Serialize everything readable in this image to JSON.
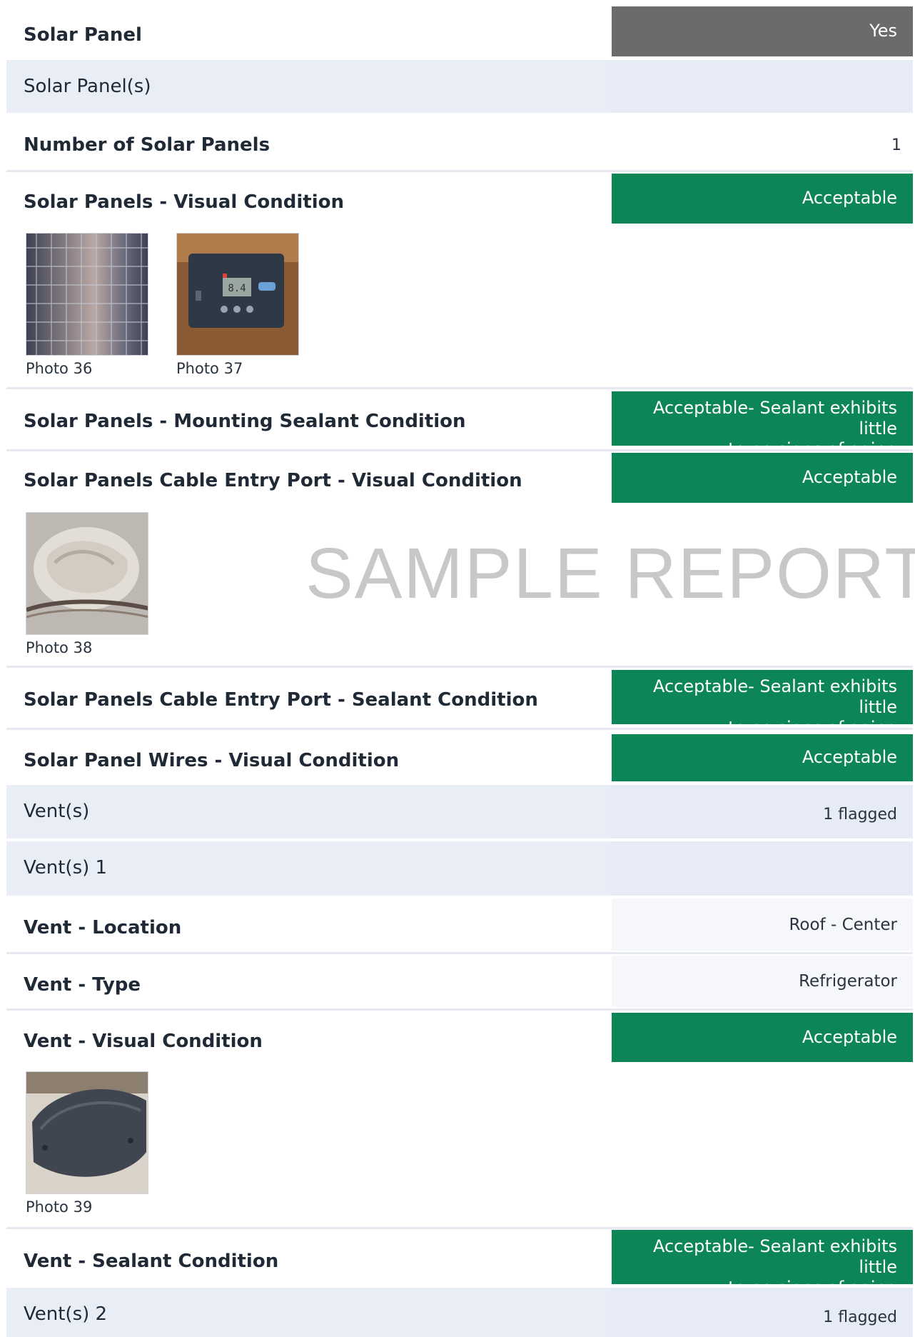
{
  "rows": {
    "solar_panel": {
      "label": "Solar Panel",
      "value": "Yes"
    },
    "solar_panels_section": {
      "label": "Solar Panel(s)"
    },
    "number_of_panels": {
      "label": "Number of Solar Panels",
      "value": "1"
    },
    "panels_visual": {
      "label": "Solar Panels - Visual Condition",
      "value": "Acceptable"
    },
    "panels_mounting": {
      "label": "Solar Panels - Mounting Sealant Condition",
      "value_line1": "Acceptable- Sealant exhibits little",
      "value_line2": "to no signs of aging"
    },
    "cable_visual": {
      "label": "Solar Panels Cable Entry Port - Visual Condition",
      "value": "Acceptable"
    },
    "cable_sealant": {
      "label": "Solar Panels Cable Entry Port - Sealant Condition",
      "value_line1": "Acceptable- Sealant exhibits little",
      "value_line2": "to no signs of aging"
    },
    "wires_visual": {
      "label": "Solar Panel Wires - Visual Condition",
      "value": "Acceptable"
    },
    "vents_section": {
      "label": "Vent(s)",
      "value": "1 flagged"
    },
    "vent1_section": {
      "label": "Vent(s) 1"
    },
    "vent_location": {
      "label": "Vent - Location",
      "value": "Roof - Center"
    },
    "vent_type": {
      "label": "Vent - Type",
      "value": "Refrigerator"
    },
    "vent_visual": {
      "label": "Vent - Visual Condition",
      "value": "Acceptable"
    },
    "vent_sealant": {
      "label": "Vent - Sealant Condition",
      "value_line1": "Acceptable- Sealant exhibits little",
      "value_line2": "to no signs of aging"
    },
    "vent2_section": {
      "label": "Vent(s) 2",
      "value": "1 flagged"
    }
  },
  "photos": {
    "p36": "Photo 36",
    "p37": "Photo 37",
    "p38": "Photo 38",
    "p39": "Photo 39"
  },
  "watermark": "SAMPLE REPORT",
  "colors": {
    "accent_green": "#0d8657",
    "badge_gray": "#6b6b6b",
    "section_band": "#e8edf6"
  }
}
